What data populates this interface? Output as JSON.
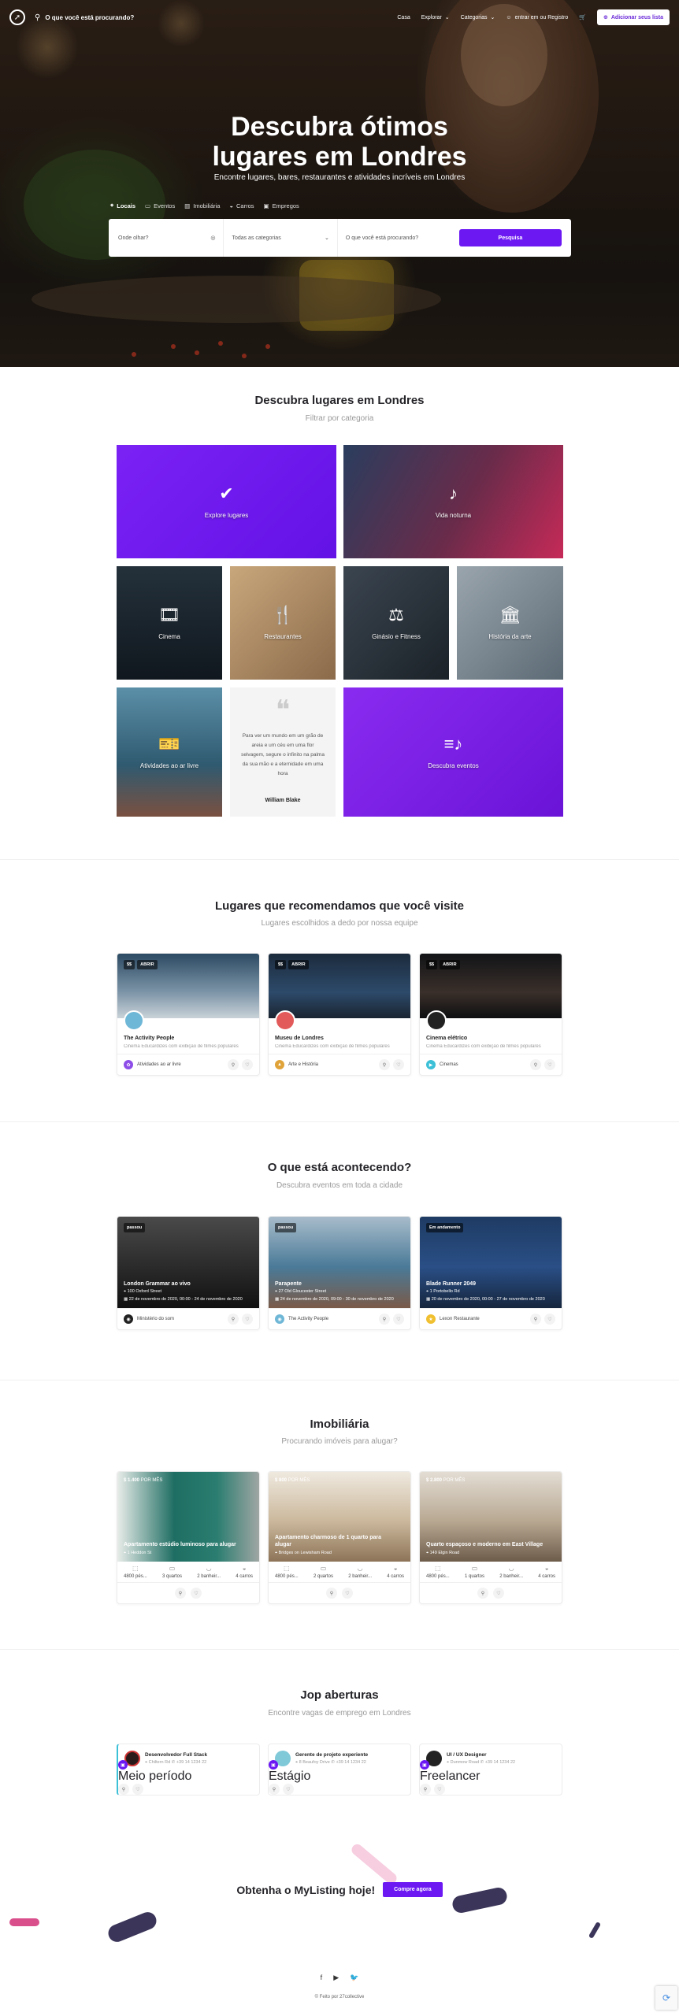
{
  "header": {
    "search_placeholder": "O que você está procurando?",
    "nav": [
      "Casa",
      "Explorar",
      "Categorias"
    ],
    "account": "entrar em ou Registro",
    "add_button": "Adicionar seus lista",
    "brand_color": "#6b18f3"
  },
  "hero": {
    "title_line1": "Descubra ótimos",
    "title_line2": "lugares em Londres",
    "subtitle": "Encontre lugares, bares, restaurantes e atividades incríveis em Londres",
    "tabs": [
      "Locais",
      "Eventos",
      "Imobiliária",
      "Carros",
      "Empregos"
    ],
    "search": {
      "where": "Onde olhar?",
      "category": "Todas as categorias",
      "what": "O que você está procurando?",
      "button": "Pesquisa"
    }
  },
  "categories": {
    "title": "Descubra lugares em Londres",
    "subtitle": "Filtrar por categoria",
    "tiles": [
      "Explore lugares",
      "Vida noturna",
      "Cinema",
      "Restaurantes",
      "Ginásio e Fitness",
      "História da arte",
      "Atividades ao ar livre",
      "Descubra eventos"
    ],
    "quote_text": "Para ver um mundo em um grão de areia e um céu em uma flor selvagem, segure o infinito na palma da sua mão e a eternidade em uma hora",
    "quote_author": "William Blake"
  },
  "recommended": {
    "title": "Lugares que recomendamos que você visite",
    "subtitle": "Lugares escolhidos a dedo por nossa equipe",
    "cards": [
      {
        "price": "$$",
        "status": "ABRIR",
        "title": "The Activity People",
        "desc": "Cinema Educardizes com exibição de filmes populares",
        "category": "Atividades ao ar livre"
      },
      {
        "price": "$$",
        "status": "ABRIR",
        "title": "Museu de Londres",
        "desc": "Cinema Educardizes com exibição de filmes populares",
        "category": "Arte e História"
      },
      {
        "price": "$$",
        "status": "ABRIR",
        "title": "Cinema elétrico",
        "desc": "Cinema Educardizes com exibição de filmes populares",
        "category": "Cinemas"
      }
    ]
  },
  "events": {
    "title": "O que está acontecendo?",
    "subtitle": "Descubra eventos em toda a cidade",
    "cards": [
      {
        "status": "passou",
        "title": "London Grammar ao vivo",
        "place": "100 Oxford Street",
        "date": "22 de novembro de 2020, 00:00 - 24 de novembro de 2020",
        "org": "Ministério do som"
      },
      {
        "status": "passou",
        "title": "Parapente",
        "place": "27 Old Gloucester Street",
        "date": "24 de novembro de 2020, 09:00 - 30 de novembro de 2020",
        "org": "The Activity People"
      },
      {
        "status": "Em andamento",
        "title": "Blade Runner 2049",
        "place": "1 Portobello Rd",
        "date": "20 de novembro de 2020, 00:00 - 27 de novembro de 2020",
        "org": "Lexon Restaurante"
      }
    ]
  },
  "realestate": {
    "title": "Imobiliária",
    "subtitle": "Procurando imóveis para alugar?",
    "cards": [
      {
        "price": "$ 1.400",
        "period": "POR MÊS",
        "title": "Apartamento estúdio luminoso para alugar",
        "place": "1 Heddon St",
        "features": [
          "4800 pés...",
          "3 quartos",
          "2 banheir...",
          "4 carros"
        ]
      },
      {
        "price": "$ 800",
        "period": "POR MÊS",
        "title": "Apartamento charmoso de 1 quarto para alugar",
        "place": "Bridges on Lewisham Road",
        "features": [
          "4800 pés...",
          "2 quartos",
          "2 banheir...",
          "4 carros"
        ]
      },
      {
        "price": "$ 2.800",
        "period": "POR MÊS",
        "title": "Quarto espaçoso e moderno em East Village",
        "place": "149 Elgin Road",
        "features": [
          "4800 pés...",
          "1 quartos",
          "2 banheir...",
          "4 carros"
        ]
      }
    ]
  },
  "jobs": {
    "title": "Jop aberturas",
    "subtitle": "Encontre vagas de emprego em Londres",
    "cards": [
      {
        "title": "Desenvolvedor Full Stack",
        "place": "Chiltern Rd",
        "phone": "+39 14 1234 22",
        "type": "Meio período"
      },
      {
        "title": "Gerente de projeto experiente",
        "place": "8 Beaufoy Drive",
        "phone": "+39 14 1234 22",
        "type": "Estágio"
      },
      {
        "title": "UI / UX Designer",
        "place": "Dunmow Road",
        "phone": "+39 14 1234 22",
        "type": "Freelancer"
      }
    ]
  },
  "cta": {
    "text": "Obtenha o MyListing hoje!",
    "button": "Compre agora"
  },
  "footer": {
    "social": [
      "f",
      "▶",
      "🐦"
    ],
    "copyright": "© Feito por 27collective"
  }
}
